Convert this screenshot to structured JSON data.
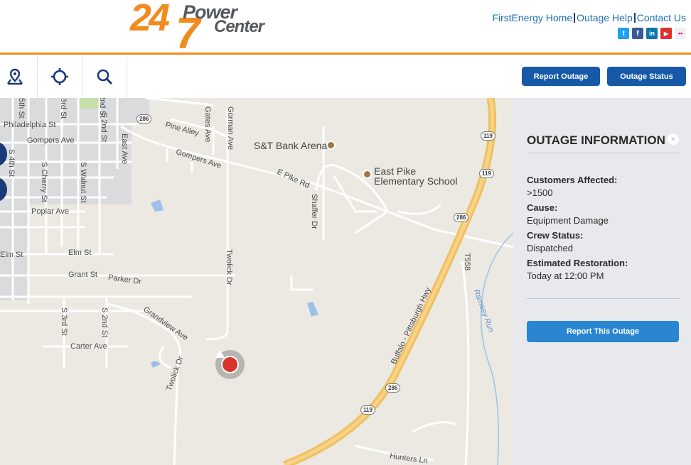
{
  "logo": {
    "number1": "24",
    "number2": "7",
    "word1": "Power",
    "word2": "Center"
  },
  "top_links": [
    "FirstEnergy Home",
    "Outage Help",
    "Contact Us"
  ],
  "social": [
    {
      "name": "twitter-icon",
      "glyph": "t",
      "color": "#1da1f2"
    },
    {
      "name": "facebook-icon",
      "glyph": "f",
      "color": "#3b5998"
    },
    {
      "name": "linkedin-icon",
      "glyph": "in",
      "color": "#0e76a8"
    },
    {
      "name": "youtube-icon",
      "glyph": "▶",
      "color": "#e02f2f"
    },
    {
      "name": "flickr-icon",
      "glyph": "••",
      "color": "#f0f0f0"
    }
  ],
  "toolbar": {
    "report_outage": "Report Outage",
    "outage_status": "Outage Status"
  },
  "map": {
    "places": [
      "S&T Bank Arena",
      "East Pike",
      "Elementary School"
    ],
    "streets": [
      "Philadelphia St",
      "S 4th St",
      "S 2nd St",
      "East Ave",
      "Gompers Ave",
      "Pine Alley",
      "Gates Ave",
      "Gorman Ave",
      "Gompers Ave",
      "E Pike Rd",
      "Shaffer Dr",
      "S Cherry St",
      "S Walnut St",
      "Poplar Ave",
      "Elm St",
      "Elm St",
      "Grant St",
      "Parker Dr",
      "Twolick Dr",
      "Grandview Ave",
      "S 3rd St",
      "S 2nd St",
      "Carter Ave",
      "Twolick Dr",
      "Buffalo - Pittsburgh Hwy",
      "T558",
      "Ramsey Run",
      "Hunters Ln",
      "5th St",
      "3rd St",
      "2nd St"
    ],
    "shields": [
      "286",
      "119",
      "119",
      "286",
      "286",
      "119"
    ]
  },
  "panel": {
    "title": "OUTAGE INFORMATION",
    "close": "×",
    "customers_label": "Customers Affected:",
    "customers_value": ">1500",
    "cause_label": "Cause:",
    "cause_value": "Equipment Damage",
    "crew_label": "Crew Status:",
    "crew_value": "Dispatched",
    "restoration_label": "Estimated Restoration:",
    "restoration_value": "Today at 12:00 PM",
    "report_button": "Report This Outage"
  }
}
